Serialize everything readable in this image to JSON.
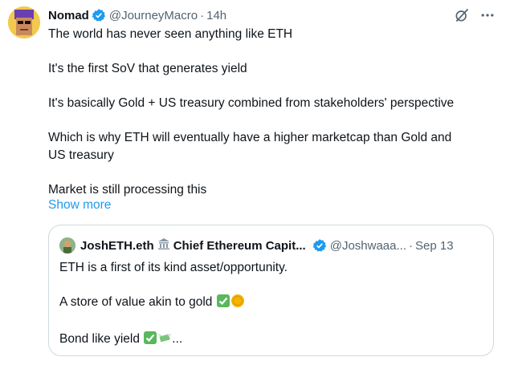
{
  "tweet": {
    "author_name": "Nomad",
    "handle": "@JourneyMacro",
    "separator": "·",
    "time": "14h",
    "lines": [
      "The world has never seen anything like ETH",
      "",
      "It's the first SoV that generates yield",
      "",
      "It's basically Gold + US treasury combined from stakeholders' perspective",
      "",
      "Which is why ETH will eventually have a higher marketcap than Gold and",
      "US treasury",
      "",
      "Market is still processing this"
    ],
    "show_more": "Show more"
  },
  "quote": {
    "author_name": "JoshETH.eth",
    "author_name_suffix": "Chief Ethereum Capit...",
    "handle": "@Joshwaaa...",
    "separator": "·",
    "date": "Sep 13",
    "line1": "ETH is a first of its kind asset/opportunity.",
    "line2": "A store of value akin to gold",
    "line3_text": "Bond like yield",
    "line3_ellipsis": "..."
  },
  "icons": {
    "grok": "grok-icon",
    "more": "more-icon",
    "verified": "verified-badge-icon",
    "bank": "bank-emoji-icon"
  },
  "colors": {
    "link": "#1d9bf0",
    "verified": "#1d9bf0",
    "secondary_text": "#536471",
    "border": "#cfd9de"
  }
}
